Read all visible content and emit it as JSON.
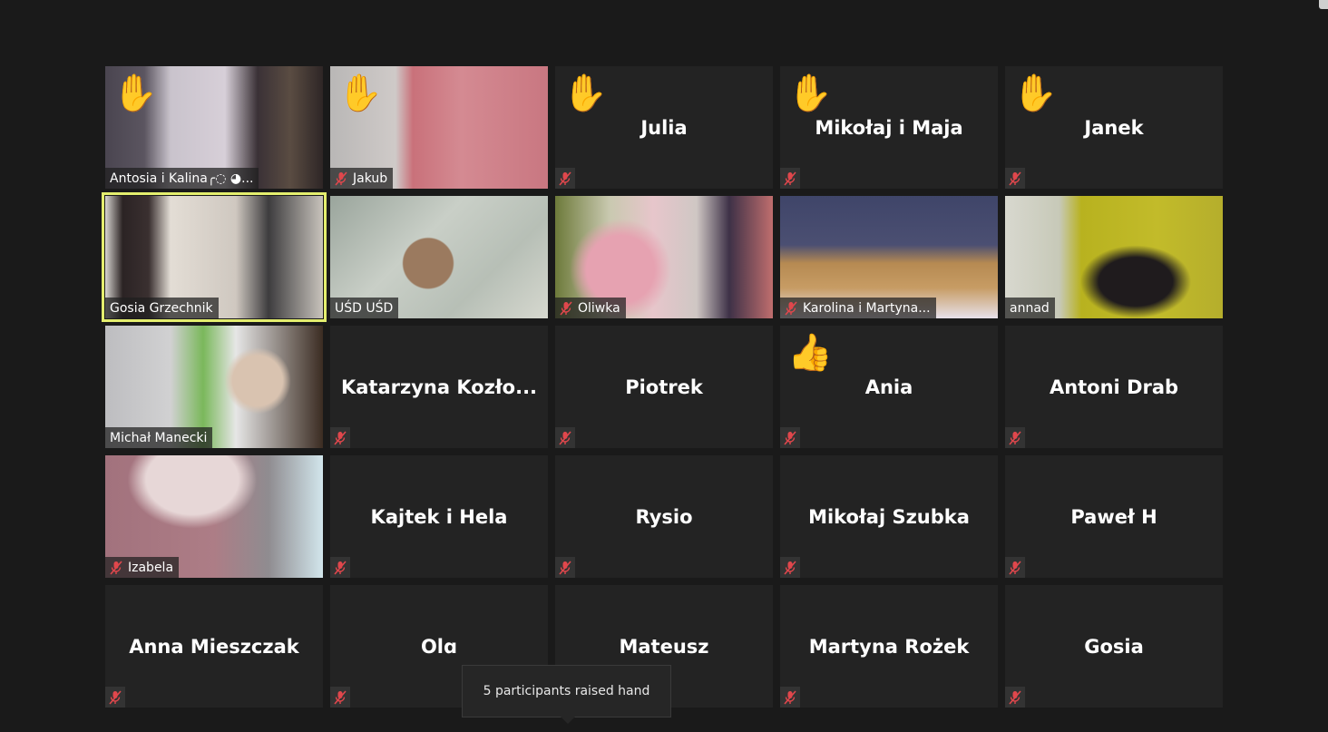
{
  "meeting": {
    "active_speaker": "annad",
    "spotlight_tile": "Gosia Grzechnik",
    "colors": {
      "background": "#1a1a1a",
      "tile_background": "#232323",
      "active_outline": "#e4ee6e",
      "speaking_bar": "#f6ef74",
      "muted_icon": "#e0474c"
    }
  },
  "participants": [
    {
      "name": "Antosia i Kalina╭◌ ◕...",
      "video": true,
      "muted": false,
      "reaction": "raised-hand",
      "reaction_glyph": "✋",
      "scene": "room-shelves"
    },
    {
      "name": "Jakub",
      "video": true,
      "muted": true,
      "reaction": "raised-hand",
      "reaction_glyph": "✋",
      "scene": "pink-wall"
    },
    {
      "name": "Julia",
      "video": false,
      "muted": true,
      "reaction": "raised-hand",
      "reaction_glyph": "✋"
    },
    {
      "name": "Mikołaj i Maja",
      "video": false,
      "muted": true,
      "reaction": "raised-hand",
      "reaction_glyph": "✋"
    },
    {
      "name": "Janek",
      "video": false,
      "muted": true,
      "reaction": "raised-hand",
      "reaction_glyph": "✋"
    },
    {
      "name": "Gosia Grzechnik",
      "video": true,
      "muted": false,
      "active": true,
      "scene": "girl-room"
    },
    {
      "name": "UŚD UŚD",
      "video": true,
      "muted": false,
      "scene": "map-wall"
    },
    {
      "name": "Oliwka",
      "video": true,
      "muted": true,
      "scene": "flowers"
    },
    {
      "name": "Karolina i Martyna...",
      "video": true,
      "muted": true,
      "scene": "sofa-blue"
    },
    {
      "name": "annad",
      "video": true,
      "muted": false,
      "speaking": true,
      "scene": "yellow-wall"
    },
    {
      "name": "Michał Manecki",
      "video": true,
      "muted": false,
      "scene": "boy-craft"
    },
    {
      "name": "Katarzyna  Kozło...",
      "video": false,
      "muted": true
    },
    {
      "name": "Piotrek",
      "video": false,
      "muted": true
    },
    {
      "name": "Ania",
      "video": false,
      "muted": true,
      "reaction": "thumbs-up",
      "reaction_glyph": "👍"
    },
    {
      "name": "Antoni Drab",
      "video": false,
      "muted": true
    },
    {
      "name": "Izabela",
      "video": true,
      "muted": true,
      "scene": "purple-sweater"
    },
    {
      "name": "Kajtek i Hela",
      "video": false,
      "muted": true
    },
    {
      "name": "Rysio",
      "video": false,
      "muted": true
    },
    {
      "name": "Mikołaj Szubka",
      "video": false,
      "muted": true
    },
    {
      "name": "Paweł H",
      "video": false,
      "muted": true
    },
    {
      "name": "Anna Mieszczak",
      "video": false,
      "muted": true
    },
    {
      "name": "Olɑ",
      "video": false,
      "muted": true
    },
    {
      "name": "Mateusz",
      "video": false,
      "muted": true
    },
    {
      "name": "Martyna Rożek",
      "video": false,
      "muted": true
    },
    {
      "name": "Gosia",
      "video": false,
      "muted": true
    }
  ],
  "tooltip": {
    "text": "5 participants raised hand"
  }
}
